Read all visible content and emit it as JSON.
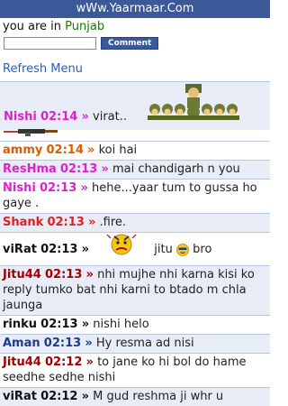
{
  "header": {
    "title": "wWw.Yaarmaar.Com"
  },
  "location": {
    "prefix": "you are in",
    "place": "Punjab"
  },
  "comment": {
    "value": "",
    "button": "Comment"
  },
  "menu": {
    "refresh": "Refresh Menu"
  },
  "colors": {
    "header_bg": "#3b5998",
    "row_alt": "#e8ecf6",
    "link": "#1f5fc9"
  },
  "messages": [
    {
      "nick": "Nishi",
      "time": "02:14",
      "text": "virat..",
      "nick_color": "#dd22cc",
      "image": "soldiers-with-gun"
    },
    {
      "nick": "ammy",
      "time": "02:14",
      "text": "koi hai",
      "nick_color": "#e05a00"
    },
    {
      "nick": "ResHma",
      "time": "02:13",
      "text": "mai chandigarh n you",
      "nick_color": "#dd22cc"
    },
    {
      "nick": "Nishi",
      "time": "02:13",
      "text": "hehe...yaar tum to gussa ho gaye .",
      "nick_color": "#dd22cc"
    },
    {
      "nick": "Shank",
      "time": "02:13",
      "text": ".fire.",
      "nick_color": "#e02020"
    },
    {
      "nick": "viRat",
      "time": "02:13",
      "text": "jitu",
      "text2": "bro",
      "nick_color": "#111111",
      "image": "angry-smiley"
    },
    {
      "nick": "Jitu44",
      "time": "02:13",
      "text": "nhi mujhe nhi karna kisi ko reply tumko bat nhi karni to btado m chla jaunga",
      "nick_color": "#a00000"
    },
    {
      "nick": "rinku",
      "time": "02:13",
      "text": "nishi helo",
      "nick_color": "#111111"
    },
    {
      "nick": "Aman",
      "time": "02:13",
      "text": "Hy resma ad nisi",
      "nick_color": "#1e3a8a"
    },
    {
      "nick": "Jitu44",
      "time": "02:12",
      "text": "to jane ko hi bol do hame seedhe sedhe nishi",
      "nick_color": "#a00000"
    },
    {
      "nick": "viRat",
      "time": "02:12",
      "text": "M gud reshma ji whr u",
      "nick_color": "#111111"
    }
  ]
}
